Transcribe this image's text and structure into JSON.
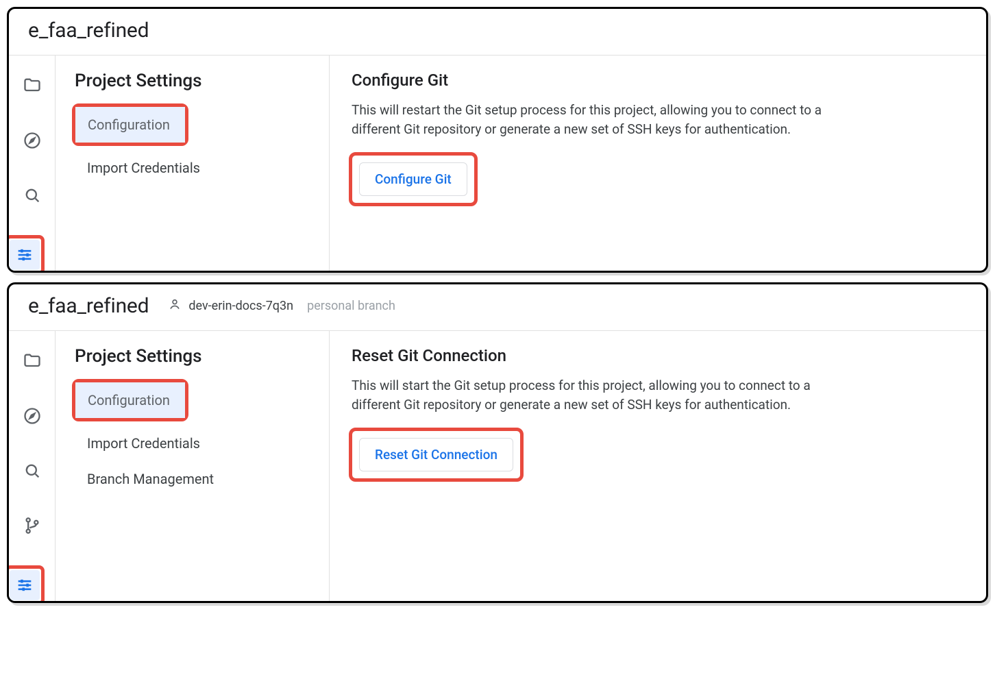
{
  "panels": [
    {
      "project": "e_faa_refined",
      "branch": null,
      "branchType": null,
      "sidebar": {
        "title": "Project Settings",
        "items": [
          "Configuration",
          "Import Credentials"
        ]
      },
      "main": {
        "heading": "Configure Git",
        "description": "This will restart the Git setup process for this project, allowing you to connect to a different Git repository or generate a new set of SSH keys for authentication.",
        "button": "Configure Git"
      }
    },
    {
      "project": "e_faa_refined",
      "branch": "dev-erin-docs-7q3n",
      "branchType": "personal branch",
      "sidebar": {
        "title": "Project Settings",
        "items": [
          "Configuration",
          "Import Credentials",
          "Branch Management"
        ]
      },
      "main": {
        "heading": "Reset Git Connection",
        "description": "This will start the Git setup process for this project, allowing you to connect to a different Git repository or generate a new set of SSH keys for authentication.",
        "button": "Reset Git Connection"
      }
    }
  ]
}
